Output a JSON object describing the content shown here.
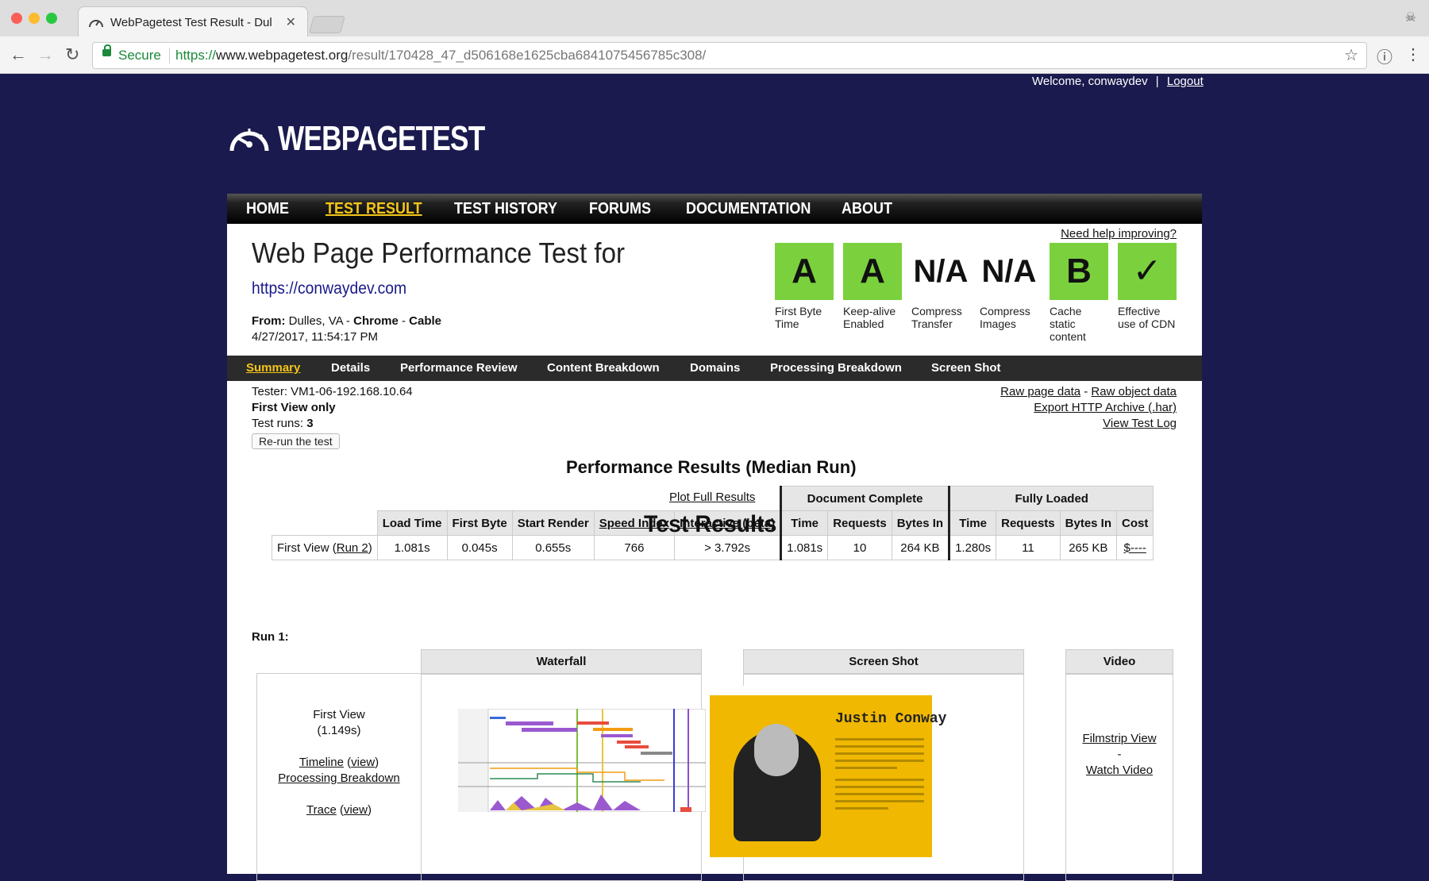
{
  "browser": {
    "tab_title": "WebPagetest Test Result - Dul",
    "secure_label": "Secure",
    "url_scheme": "https://",
    "url_host": "www.webpagetest.org",
    "url_path": "/result/170428_47_d506168e1625cba6841075456785c308/"
  },
  "header": {
    "welcome": "Welcome, conwaydev",
    "separator": "|",
    "logout": "Logout",
    "logo_text": "WEBPAGETEST"
  },
  "menu": [
    "HOME",
    "TEST RESULT",
    "TEST HISTORY",
    "FORUMS",
    "DOCUMENTATION",
    "ABOUT"
  ],
  "menu_active": "TEST RESULT",
  "test": {
    "help_link": "Need help improving?",
    "title": "Web Page Performance Test for",
    "url": "https://conwaydev.com",
    "from_label": "From:",
    "from_location": "Dulles, VA",
    "from_dash1": " - ",
    "from_browser": "Chrome",
    "from_dash2": " - ",
    "from_connection": "Cable",
    "date": "4/27/2017, 11:54:17 PM"
  },
  "grades": [
    {
      "grade": "A",
      "label": "First Byte Time",
      "style": "green"
    },
    {
      "grade": "A",
      "label": "Keep-alive Enabled",
      "style": "green"
    },
    {
      "grade": "N/A",
      "label": "Compress Transfer",
      "style": "na"
    },
    {
      "grade": "N/A",
      "label": "Compress Images",
      "style": "na"
    },
    {
      "grade": "B",
      "label": "Cache static content",
      "style": "green"
    },
    {
      "grade": "✓",
      "label": "Effective use of CDN",
      "style": "green"
    }
  ],
  "colors": {
    "grade_green": "#7bd13d",
    "active_tab": "#f5c518",
    "page_bg": "#1b1a4e"
  },
  "subnav": [
    "Summary",
    "Details",
    "Performance Review",
    "Content Breakdown",
    "Domains",
    "Processing Breakdown",
    "Screen Shot"
  ],
  "subnav_active": "Summary",
  "info": {
    "tester": "Tester: VM1-06-192.168.10.64",
    "first_view_only": "First View only",
    "test_runs_label": "Test runs: ",
    "test_runs_value": "3",
    "rerun_button": "Re-run the test",
    "raw_page_data": "Raw page data",
    "link_dash": " - ",
    "raw_object_data": "Raw object data",
    "export_har": "Export HTTP Archive (.har)",
    "view_test_log": "View Test Log"
  },
  "performance": {
    "heading": "Performance Results (Median Run)",
    "group_document": "Document Complete",
    "group_fully": "Fully Loaded",
    "columns": [
      "Load Time",
      "First Byte",
      "Start Render",
      "Speed Index",
      "Interactive (beta)",
      "Time",
      "Requests",
      "Bytes In",
      "Time",
      "Requests",
      "Bytes In",
      "Cost"
    ],
    "row_label": "First View (",
    "row_run_link": "Run 2",
    "row_label_end": ")",
    "row_values": [
      "1.081s",
      "0.045s",
      "0.655s",
      "766",
      "> 3.792s",
      "1.081s",
      "10",
      "264 KB",
      "1.280s",
      "11",
      "265 KB",
      "$----"
    ],
    "plot_link": "Plot Full Results"
  },
  "results": {
    "heading": "Test Results",
    "run_label": "Run 1:",
    "col_waterfall": "Waterfall",
    "col_screenshot": "Screen Shot",
    "col_video": "Video",
    "first_view": "First View",
    "first_view_time": "(1.149s)",
    "timeline": "Timeline",
    "view": "view",
    "processing_breakdown": "Processing Breakdown",
    "trace": "Trace",
    "filmstrip": "Filmstrip View",
    "video_dash": "-",
    "watch_video": "Watch Video",
    "screenshot_name": "Justin Conway"
  }
}
